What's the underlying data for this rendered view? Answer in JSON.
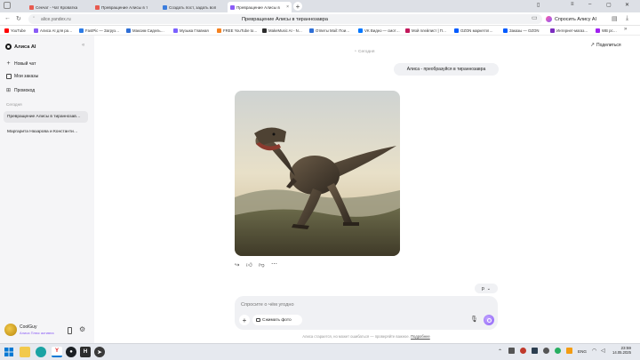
{
  "browser": {
    "tabs": [
      {
        "label": "Секчат - Чат Кроватка",
        "color": "#e85a4f"
      },
      {
        "label": "Превращение Алисы в т",
        "color": "#e85a4f"
      },
      {
        "label": "Создать пост, задать воп",
        "color": "#3b7ddd"
      },
      {
        "label": "Превращение Алисы в",
        "color": "#8a5cf6"
      }
    ],
    "new_tab_symbol": "+",
    "url": "alice.yandex.ru",
    "page_title": "Превращение Алисы в тираннозавра",
    "ask_alice": "Спросить Алису AI",
    "bookmarks": [
      {
        "label": "YouTube",
        "color": "#ff0000"
      },
      {
        "label": "Алиса AI для ра…",
        "color": "#8a5cf6"
      },
      {
        "label": "FastPic — Загруз…",
        "color": "#2c7be5"
      },
      {
        "label": "Максим Сидель…",
        "color": "#2f6fd6"
      },
      {
        "label": "Музыка Главная",
        "color": "#7b61ff"
      },
      {
        "label": "FREE YouTube to…",
        "color": "#f58220"
      },
      {
        "label": "MakeMusic AI - N…",
        "color": "#2c2c2c"
      },
      {
        "label": "Ответы Mail: Пои…",
        "color": "#2f6fd6"
      },
      {
        "label": "VK Видео — смот…",
        "color": "#0077ff"
      },
      {
        "label": "Мой плейлист | П…",
        "color": "#c2185b"
      },
      {
        "label": "OZON маркетпл…",
        "color": "#005bff"
      },
      {
        "label": "Заказы — OZON",
        "color": "#005bff"
      },
      {
        "label": "Интернет-магаз…",
        "color": "#7b2cbf"
      },
      {
        "label": "WB pc…",
        "color": "#a020f0"
      }
    ]
  },
  "sidebar": {
    "brand": "Алиса AI",
    "items": [
      {
        "label": "Новый чат",
        "icon": "plus-icon"
      },
      {
        "label": "Мои заказы",
        "icon": "bag-icon"
      },
      {
        "label": "Промокод",
        "icon": "gift-icon"
      }
    ],
    "section_today": "Сегодня",
    "chats": [
      {
        "label": "Превращение Алисы в тираннозав…",
        "active": true
      },
      {
        "label": "Маргарита Назарова и Константи…",
        "active": false
      }
    ],
    "user": {
      "name": "CoolGuy",
      "subtitle": "Алиса Плюс активна"
    }
  },
  "chat": {
    "share": "Поделиться",
    "date_label": "Сегодня",
    "user_message": "Алиса - преобразуйся в тираннозавра",
    "image_alt": "Тираннозавр",
    "scroll_label": "р",
    "input_placeholder": "Спросите о чём угодно",
    "compress_photo": "Сжимать фото",
    "disclaimer": "Алиса старается, но может ошибаться — проверяйте важное.",
    "disclaimer_link": "Подробнее"
  },
  "taskbar": {
    "lang": "ENG",
    "time": "23:59",
    "date": "14.05.2025"
  },
  "colors": {
    "accent": "#8a5cf6",
    "bubble": "#f0f1f4",
    "sidebar_bg": "#f5f5f7"
  }
}
